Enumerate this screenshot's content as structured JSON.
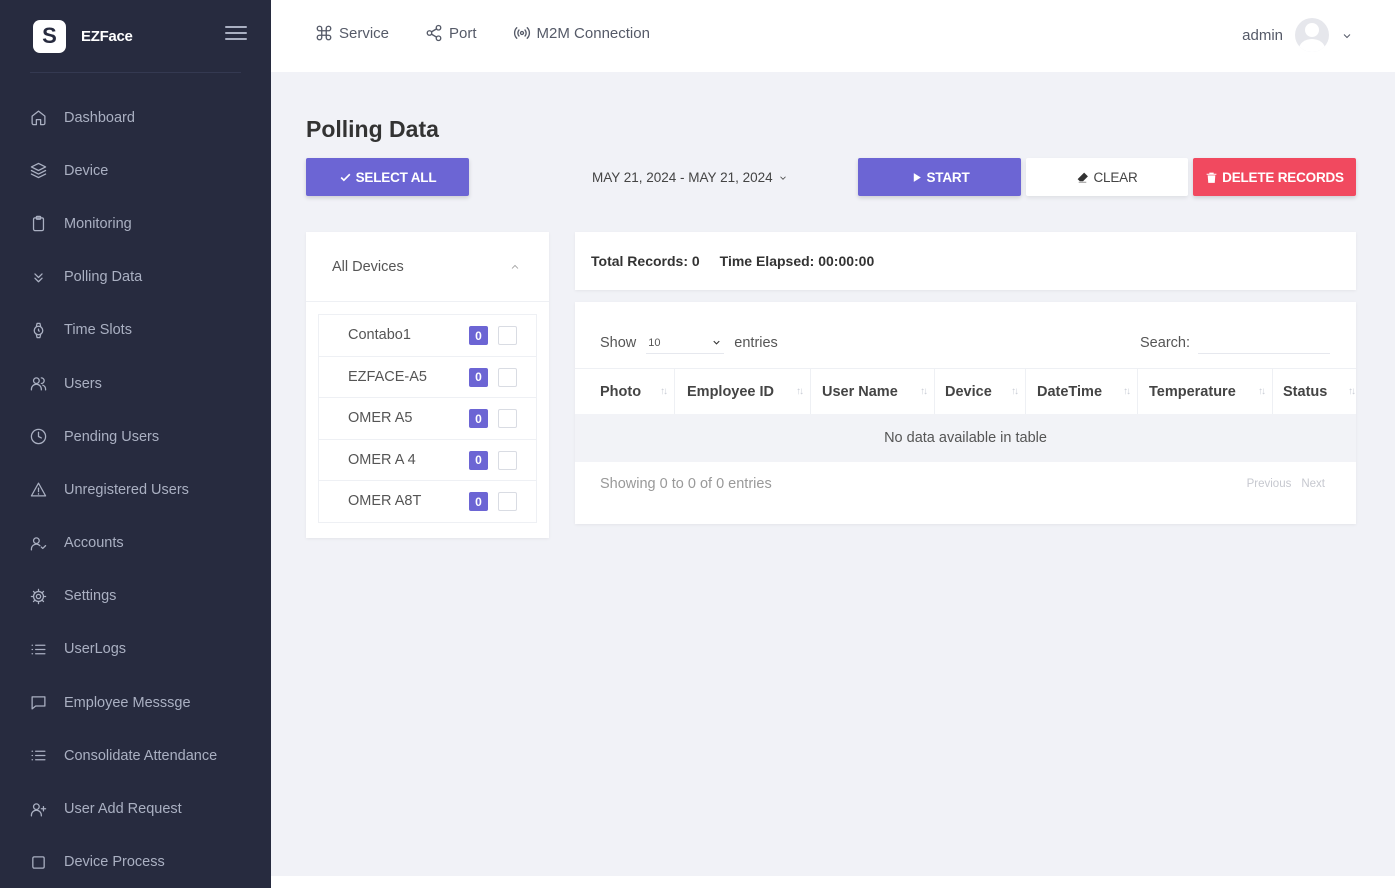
{
  "brand": {
    "logo_letter": "S",
    "name": "EZFace"
  },
  "sidebar": {
    "items": [
      {
        "label": "Dashboard",
        "icon": "home-icon"
      },
      {
        "label": "Device",
        "icon": "layers-icon"
      },
      {
        "label": "Monitoring",
        "icon": "clipboard-icon"
      },
      {
        "label": "Polling Data",
        "icon": "chevrons-down-icon"
      },
      {
        "label": "Time Slots",
        "icon": "watch-icon"
      },
      {
        "label": "Users",
        "icon": "users-icon"
      },
      {
        "label": "Pending Users",
        "icon": "clock-icon"
      },
      {
        "label": "Unregistered Users",
        "icon": "alert-triangle-icon"
      },
      {
        "label": "Accounts",
        "icon": "user-check-icon"
      },
      {
        "label": "Settings",
        "icon": "gear-icon"
      },
      {
        "label": "UserLogs",
        "icon": "list-icon"
      },
      {
        "label": "Employee Messsge",
        "icon": "message-square-icon"
      },
      {
        "label": "Consolidate Attendance",
        "icon": "list-icon"
      },
      {
        "label": "User Add Request",
        "icon": "user-plus-icon"
      },
      {
        "label": "Device Process",
        "icon": "square-icon"
      }
    ]
  },
  "topbar": {
    "menu": [
      {
        "label": "Service",
        "icon": "command-icon"
      },
      {
        "label": "Port",
        "icon": "share-icon"
      },
      {
        "label": "M2M Connection",
        "icon": "broadcast-icon"
      }
    ],
    "username": "admin"
  },
  "page": {
    "title": "Polling Data",
    "select_all": "SELECT ALL",
    "date_range": "MAY 21, 2024 - MAY 21, 2024",
    "start": "START",
    "clear": "CLEAR",
    "delete_records": "DELETE RECORDS"
  },
  "devices": {
    "header": "All Devices",
    "list": [
      {
        "name": "Contabo1",
        "count": "0"
      },
      {
        "name": "EZFACE-A5",
        "count": "0"
      },
      {
        "name": "OMER A5",
        "count": "0"
      },
      {
        "name": "OMER A 4",
        "count": "0"
      },
      {
        "name": "OMER A8T",
        "count": "0"
      }
    ]
  },
  "records": {
    "total_records": "Total Records: 0",
    "time_elapsed": "Time Elapsed: 00:00:00"
  },
  "table": {
    "show_label": "Show",
    "show_value": "10",
    "entries_label": "entries",
    "search_label": "Search:",
    "search_value": "",
    "columns": [
      "Photo",
      "Employee ID",
      "User Name",
      "Device",
      "DateTime",
      "Temperature",
      "Status"
    ],
    "no_data": "No data available in table",
    "showing": "Showing 0 to 0 of 0 entries",
    "previous": "Previous",
    "next": "Next"
  },
  "colors": {
    "sidebar_bg": "#272b3f",
    "primary": "#6c65d4",
    "danger": "#f1495f",
    "page_bg": "#f1f2f7"
  }
}
